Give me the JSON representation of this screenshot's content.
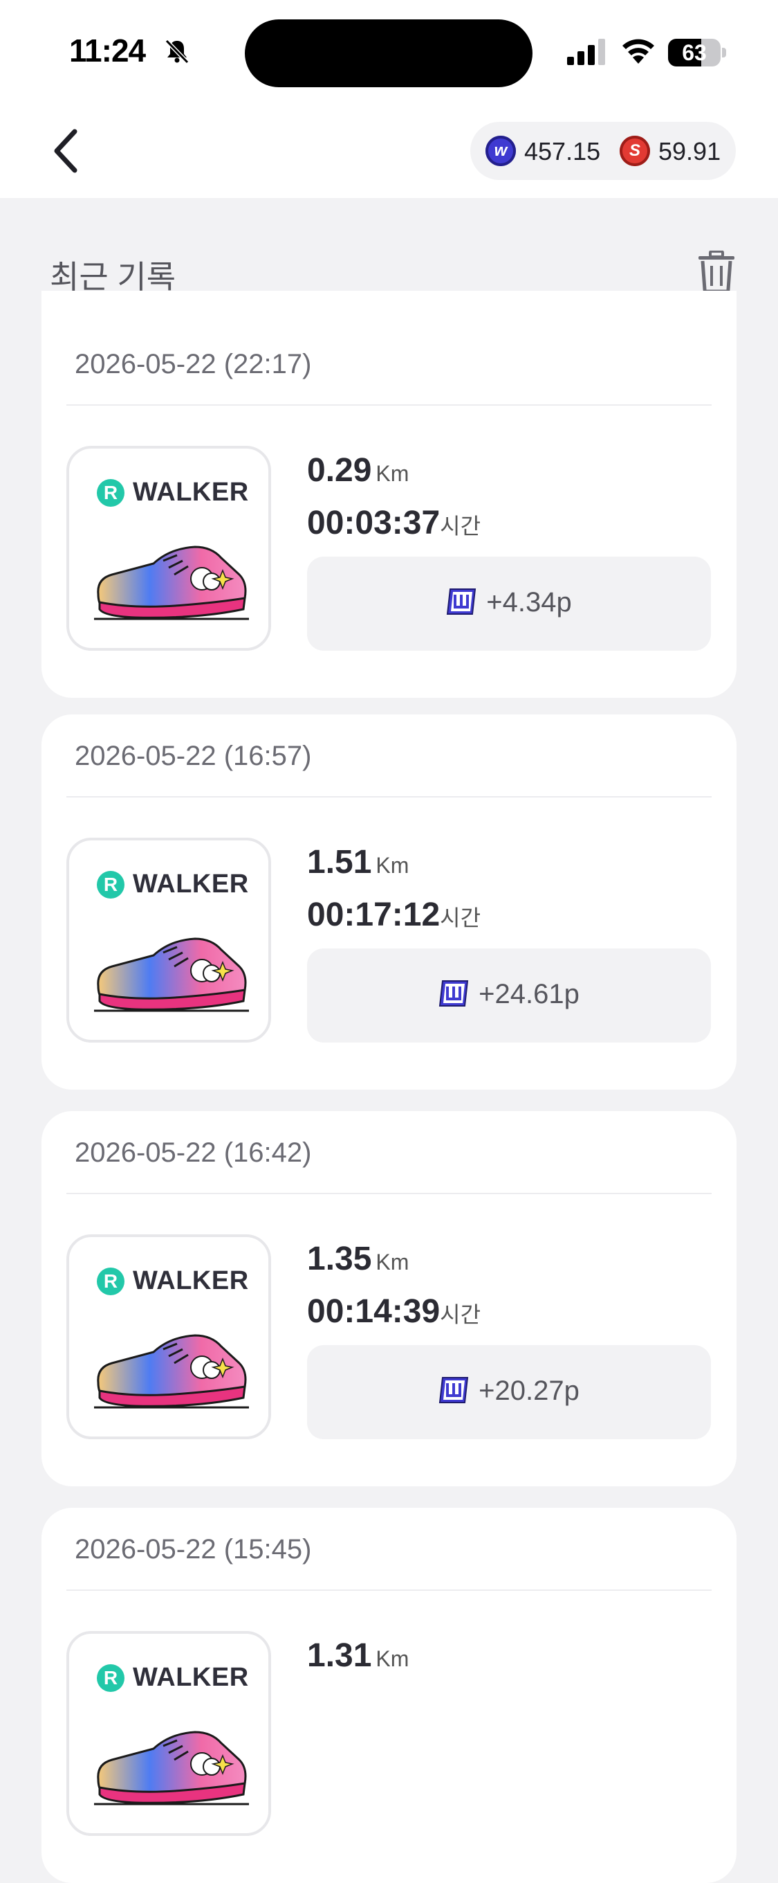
{
  "status_bar": {
    "time": "11:24",
    "battery": "63",
    "battery_level_percent": 63
  },
  "header": {
    "balances": [
      {
        "icon": "w-coin-icon",
        "value": "457.15",
        "color": "#3f3ad1"
      },
      {
        "icon": "s-coin-icon",
        "value": "59.91",
        "color": "#e23a33"
      }
    ]
  },
  "section": {
    "title": "최근 기록"
  },
  "records": [
    {
      "date": "2026-05-22 (22:17)",
      "brand": "WALKER",
      "brand_badge": "R",
      "distance": "0.29",
      "distance_unit": "Km",
      "duration": "00:03:37",
      "duration_unit": "시간",
      "reward": "+4.34p"
    },
    {
      "date": "2026-05-22 (16:57)",
      "brand": "WALKER",
      "brand_badge": "R",
      "distance": "1.51",
      "distance_unit": "Km",
      "duration": "00:17:12",
      "duration_unit": "시간",
      "reward": "+24.61p"
    },
    {
      "date": "2026-05-22 (16:42)",
      "brand": "WALKER",
      "brand_badge": "R",
      "distance": "1.35",
      "distance_unit": "Km",
      "duration": "00:14:39",
      "duration_unit": "시간",
      "reward": "+20.27p"
    },
    {
      "date": "2026-05-22 (15:45)",
      "brand": "WALKER",
      "brand_badge": "R",
      "distance": "1.31",
      "distance_unit": "Km",
      "duration": "",
      "duration_unit": "",
      "reward": ""
    }
  ],
  "colors": {
    "accent": "#3f3ad1",
    "brand_green": "#22c8a9",
    "background": "#f2f2f4"
  }
}
